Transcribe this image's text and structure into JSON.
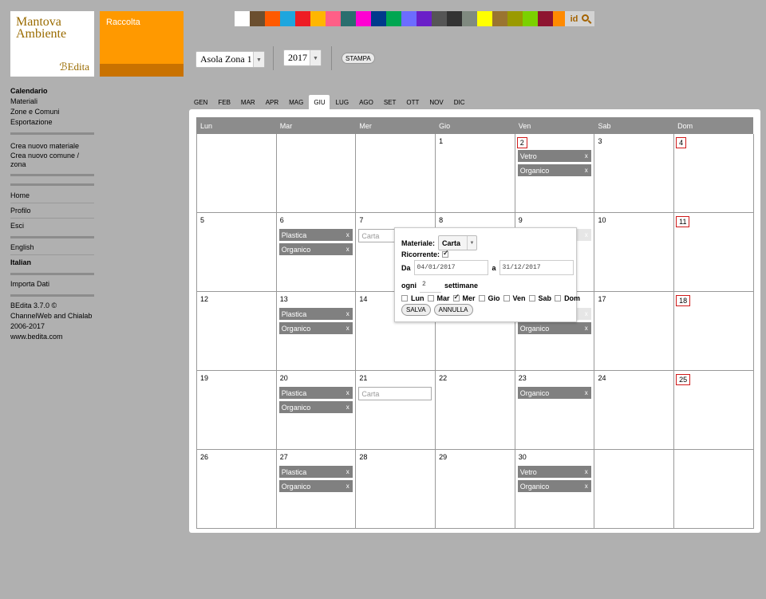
{
  "header": {
    "logo_title": "Mantova Ambiente",
    "logo_sub": "ℬEdita",
    "module_label": "Raccolta",
    "palette": [
      "#ffffff",
      "#6b4f2f",
      "#ff5a00",
      "#1ea6de",
      "#ee1c24",
      "#ffb600",
      "#ff5f87",
      "#2a6e6e",
      "#ff00d2",
      "#003a8c",
      "#00a651",
      "#6c6cff",
      "#6a1fc8",
      "#555555",
      "#333333",
      "#808a80",
      "#ffff00",
      "#9a7430",
      "#9a9a00",
      "#7bd100",
      "#8e1430",
      "#ff8a00"
    ],
    "id_label": "id"
  },
  "toolbar": {
    "zone": "Asola Zona 1",
    "year": "2017",
    "print_label": "STAMPA"
  },
  "sidebar": {
    "group1": [
      "Calendario",
      "Materiali",
      "Zone e Comuni",
      "Esportazione"
    ],
    "group2": [
      "Crea nuovo materiale",
      "Crea nuovo comune / zona"
    ],
    "group3": [
      "Home",
      "Profilo",
      "Esci"
    ],
    "lang": [
      "English",
      "Italian"
    ],
    "import": "Importa Dati",
    "footer": [
      "BEdita 3.7.0 ©",
      "ChannelWeb and Chialab",
      "2006-2017",
      "www.bedita.com"
    ]
  },
  "months": [
    "GEN",
    "FEB",
    "MAR",
    "APR",
    "MAG",
    "GIU",
    "LUG",
    "AGO",
    "SET",
    "OTT",
    "NOV",
    "DIC"
  ],
  "active_month": "GIU",
  "calendar": {
    "weekdays": [
      "Lun",
      "Mar",
      "Mer",
      "Gio",
      "Ven",
      "Sab",
      "Dom"
    ],
    "weeks": [
      [
        {
          "day": ""
        },
        {
          "day": ""
        },
        {
          "day": ""
        },
        {
          "day": "1"
        },
        {
          "day": "2",
          "holiday": true,
          "tags": [
            "Vetro",
            "Organico"
          ]
        },
        {
          "day": "3"
        },
        {
          "day": "4",
          "holiday": true
        }
      ],
      [
        {
          "day": "5"
        },
        {
          "day": "6",
          "tags": [
            "Plastica",
            "Organico"
          ]
        },
        {
          "day": "7",
          "input": "Carta"
        },
        {
          "day": "8"
        },
        {
          "day": "9",
          "ghost": "Organico"
        },
        {
          "day": "10"
        },
        {
          "day": "11",
          "holiday": true
        }
      ],
      [
        {
          "day": "12"
        },
        {
          "day": "13",
          "tags": [
            "Plastica",
            "Organico"
          ]
        },
        {
          "day": "14"
        },
        {
          "day": "15"
        },
        {
          "day": "16",
          "ghost": "Vetro",
          "tags2": [
            "Organico"
          ]
        },
        {
          "day": "17"
        },
        {
          "day": "18",
          "holiday": true
        }
      ],
      [
        {
          "day": "19"
        },
        {
          "day": "20",
          "tags": [
            "Plastica",
            "Organico"
          ]
        },
        {
          "day": "21",
          "input": "Carta"
        },
        {
          "day": "22"
        },
        {
          "day": "23",
          "tags": [
            "Organico"
          ]
        },
        {
          "day": "24"
        },
        {
          "day": "25",
          "holiday": true
        }
      ],
      [
        {
          "day": "26"
        },
        {
          "day": "27",
          "tags": [
            "Plastica",
            "Organico"
          ]
        },
        {
          "day": "28"
        },
        {
          "day": "29"
        },
        {
          "day": "30",
          "tags": [
            "Vetro",
            "Organico"
          ]
        },
        {
          "day": ""
        },
        {
          "day": ""
        }
      ]
    ],
    "tag_close": "x"
  },
  "popup": {
    "material_label": "Materiale:",
    "material_value": "Carta",
    "recurrent_label": "Ricorrente:",
    "from_label": "Da",
    "from_value": "04/01/2017",
    "to_label": "a",
    "to_value": "31/12/2017",
    "every_label": "ogni",
    "every_value": "2",
    "weeks_label": "settimane",
    "days": [
      {
        "label": "Lun",
        "checked": false
      },
      {
        "label": "Mar",
        "checked": false
      },
      {
        "label": "Mer",
        "checked": true
      },
      {
        "label": "Gio",
        "checked": false
      },
      {
        "label": "Ven",
        "checked": false
      },
      {
        "label": "Sab",
        "checked": false
      },
      {
        "label": "Dom",
        "checked": false
      }
    ],
    "save_label": "SALVA",
    "cancel_label": "ANNULLA"
  }
}
